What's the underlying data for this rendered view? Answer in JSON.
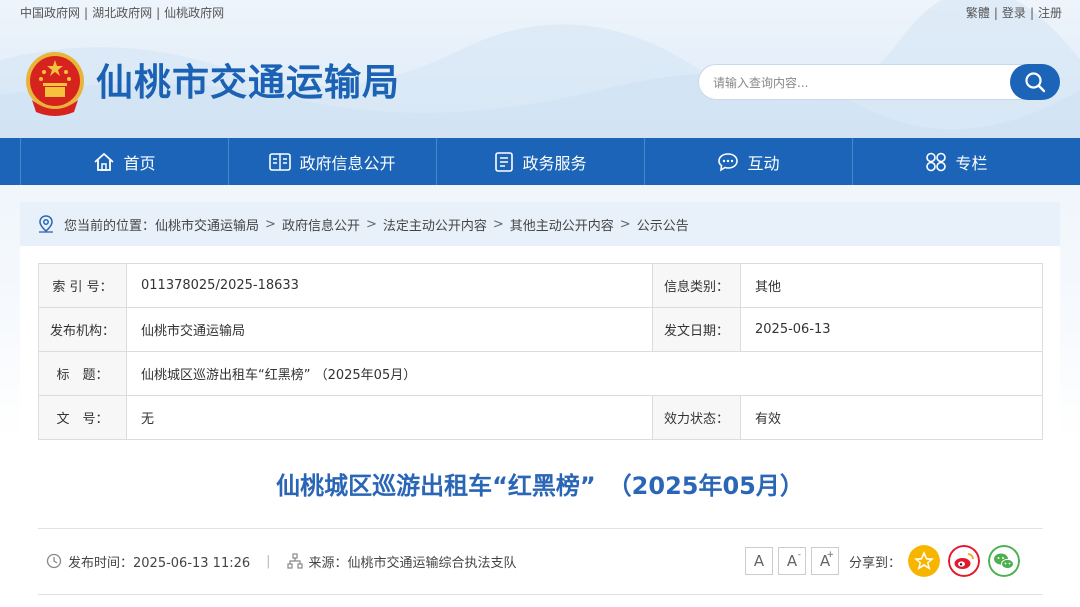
{
  "top_links": {
    "links": [
      "中国政府网",
      "湖北政府网",
      "仙桃政府网"
    ],
    "right": [
      "繁體",
      "登录",
      "注册"
    ]
  },
  "site": {
    "name": "仙桃市交通运输局",
    "emblem": "national-emblem"
  },
  "search": {
    "placeholder": "请输入查询内容..."
  },
  "nav": {
    "items": [
      {
        "label": "首页",
        "icon": "home-icon"
      },
      {
        "label": "政府信息公开",
        "icon": "info-open-icon"
      },
      {
        "label": "政务服务",
        "icon": "service-doc-icon"
      },
      {
        "label": "互动",
        "icon": "chat-icon"
      },
      {
        "label": "专栏",
        "icon": "grid-icon"
      }
    ]
  },
  "breadcrumb": {
    "prefix": "您当前的位置：",
    "items": [
      "仙桃市交通运输局",
      "政府信息公开",
      "法定主动公开内容",
      "其他主动公开内容",
      "公示公告"
    ]
  },
  "meta": {
    "index_label": "索 引 号：",
    "index_value": "011378025/2025-18633",
    "category_label": "信息类别：",
    "category_value": "其他",
    "org_label": "发布机构：",
    "org_value": "仙桃市交通运输局",
    "date_label": "发文日期：",
    "date_value": "2025-06-13",
    "title_label": "标　题：",
    "title_value": "仙桃城区巡游出租车“红黑榜” （2025年05月）",
    "docno_label": "文　号：",
    "docno_value": "无",
    "status_label": "效力状态：",
    "status_value": "有效"
  },
  "article": {
    "title": "仙桃城区巡游出租车“红黑榜”　（2025年05月）",
    "publish_time": "发布时间：2025-06-13 11:26",
    "source": "来源：仙桃市交通运输综合执法支队"
  },
  "tools": {
    "font_small": "A",
    "font_minus": "A",
    "font_plus": "A",
    "minus_sign": "-",
    "plus_sign": "+",
    "share_label": "分享到："
  },
  "colors": {
    "brand": "#1b64b8",
    "title": "#2a66b5",
    "qzone": "#f7b500",
    "weibo": "#e6162d",
    "wechat": "#4caf50"
  }
}
